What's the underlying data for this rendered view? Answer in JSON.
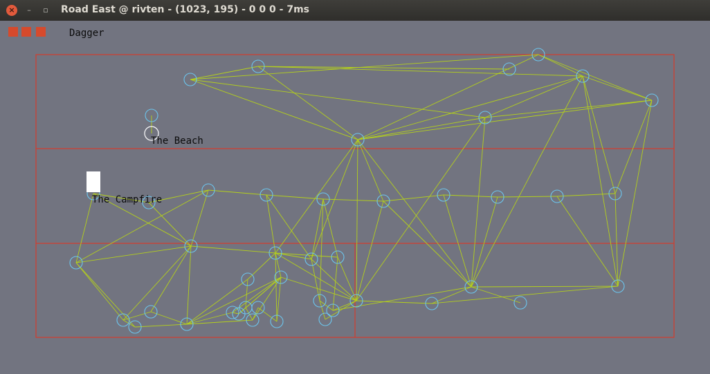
{
  "window": {
    "title": "Road East @ rivten - (1023, 195) - 0 0 0 - 7ms",
    "close_icon": "close-icon",
    "minimize_icon": "minimize-icon",
    "maximize_icon": "maximize-icon"
  },
  "toolbar": {
    "squares": [
      "red-square-1",
      "red-square-2",
      "red-square-3"
    ],
    "accent": "#d64a2c",
    "item_label": "Dagger"
  },
  "map": {
    "grid_color": "#d43c2c",
    "edge_color": "#b5d11b",
    "node_color": "#6cc6ee",
    "highlight_node_color": "#ffffff",
    "labels": {
      "beach": "The Beach",
      "campfire": "The Campfire"
    }
  }
}
